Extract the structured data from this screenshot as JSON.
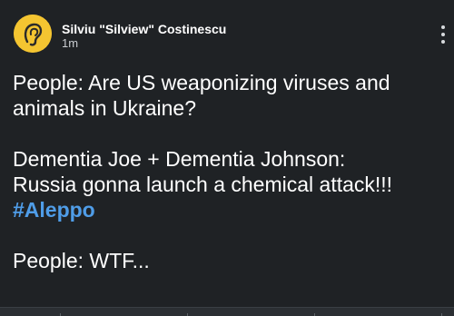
{
  "post": {
    "author": "Silviu \"Silview\" Costinescu",
    "time": "1m",
    "lines": [
      "People: Are US weaponizing viruses and",
      "animals in Ukraine?",
      "Dementia Joe + Dementia Johnson:",
      "Russia gonna launch a chemical attack!!!",
      "People: WTF..."
    ],
    "hashtag": "#Aleppo"
  },
  "icons": {
    "avatar": "ear-logo-icon",
    "menu": "more-vertical-icon"
  },
  "colors": {
    "background": "#1f2225",
    "text": "#ffffff",
    "hashtag": "#4f9de8",
    "avatar": "#f4c531"
  }
}
